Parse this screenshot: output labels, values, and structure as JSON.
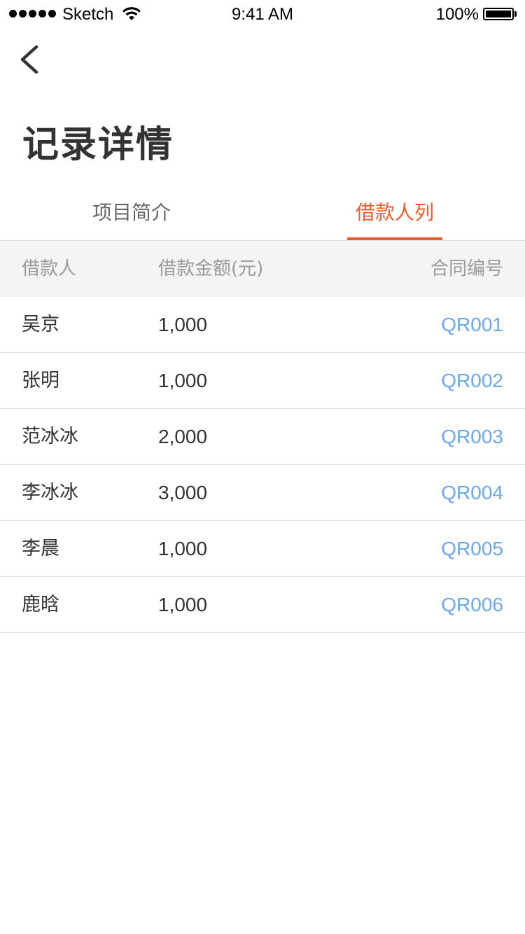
{
  "status_bar": {
    "carrier": "Sketch",
    "time": "9:41 AM",
    "battery": "100%"
  },
  "nav": {
    "back_icon": "chevron-left-icon"
  },
  "page": {
    "title": "记录详情"
  },
  "tabs": [
    {
      "label": "项目简介",
      "active": false
    },
    {
      "label": "借款人列表",
      "active": true
    }
  ],
  "table": {
    "headers": {
      "name": "借款人",
      "amount": "借款金额(元)",
      "contract": "合同编号"
    },
    "rows": [
      {
        "name": "吴京",
        "amount": "1,000",
        "contract": "QR001"
      },
      {
        "name": "张明",
        "amount": "1,000",
        "contract": "QR002"
      },
      {
        "name": "范冰冰",
        "amount": "2,000",
        "contract": "QR003"
      },
      {
        "name": "李冰冰",
        "amount": "3,000",
        "contract": "QR004"
      },
      {
        "name": "李晨",
        "amount": "1,000",
        "contract": "QR005"
      },
      {
        "name": "鹿晗",
        "amount": "1,000",
        "contract": "QR006"
      }
    ]
  },
  "colors": {
    "accent": "#f15a2b",
    "link": "#6aa8ee",
    "header_bg": "#f4f4f4"
  }
}
